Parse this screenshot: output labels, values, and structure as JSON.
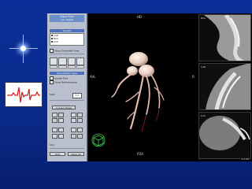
{
  "window": {
    "title": "Vessel Tools",
    "subtitle": "Cor. Seeds"
  },
  "sections": {
    "vessels": "Vessels",
    "visualization": "Visualization type",
    "vessel_list": [
      "LAD",
      "RCA",
      "LCX"
    ]
  },
  "options": {
    "show_extended_view": "Show Extended View",
    "isolate_tree": "Isolate Tree",
    "show_reformations": "Show Reformations"
  },
  "controls": {
    "slab_label": "Slab",
    "slab_value": "1.0",
    "curved_button": "Curved Views",
    "unit_label": "mm",
    "ok_button": "Exit",
    "save_button": "Save All"
  },
  "viewport": {
    "left_marker": "AVL",
    "top_marker": "HD",
    "bottom_marker": "FDA",
    "right_marker": "R"
  },
  "side_views": [
    {
      "label": "RCA"
    },
    {
      "label": "LAD"
    },
    {
      "label": "LCX"
    }
  ],
  "status": {
    "zoom": "1:1.00"
  },
  "icons": {
    "ecg": "ecg-trace-icon",
    "orientation": "orientation-cube-icon"
  },
  "colors": {
    "background": "#0a2a8c",
    "panel": "#b9bfcc",
    "header": "#4b6fb8",
    "ecg_trace": "#d01818",
    "vessel": "#e6b8b0"
  }
}
